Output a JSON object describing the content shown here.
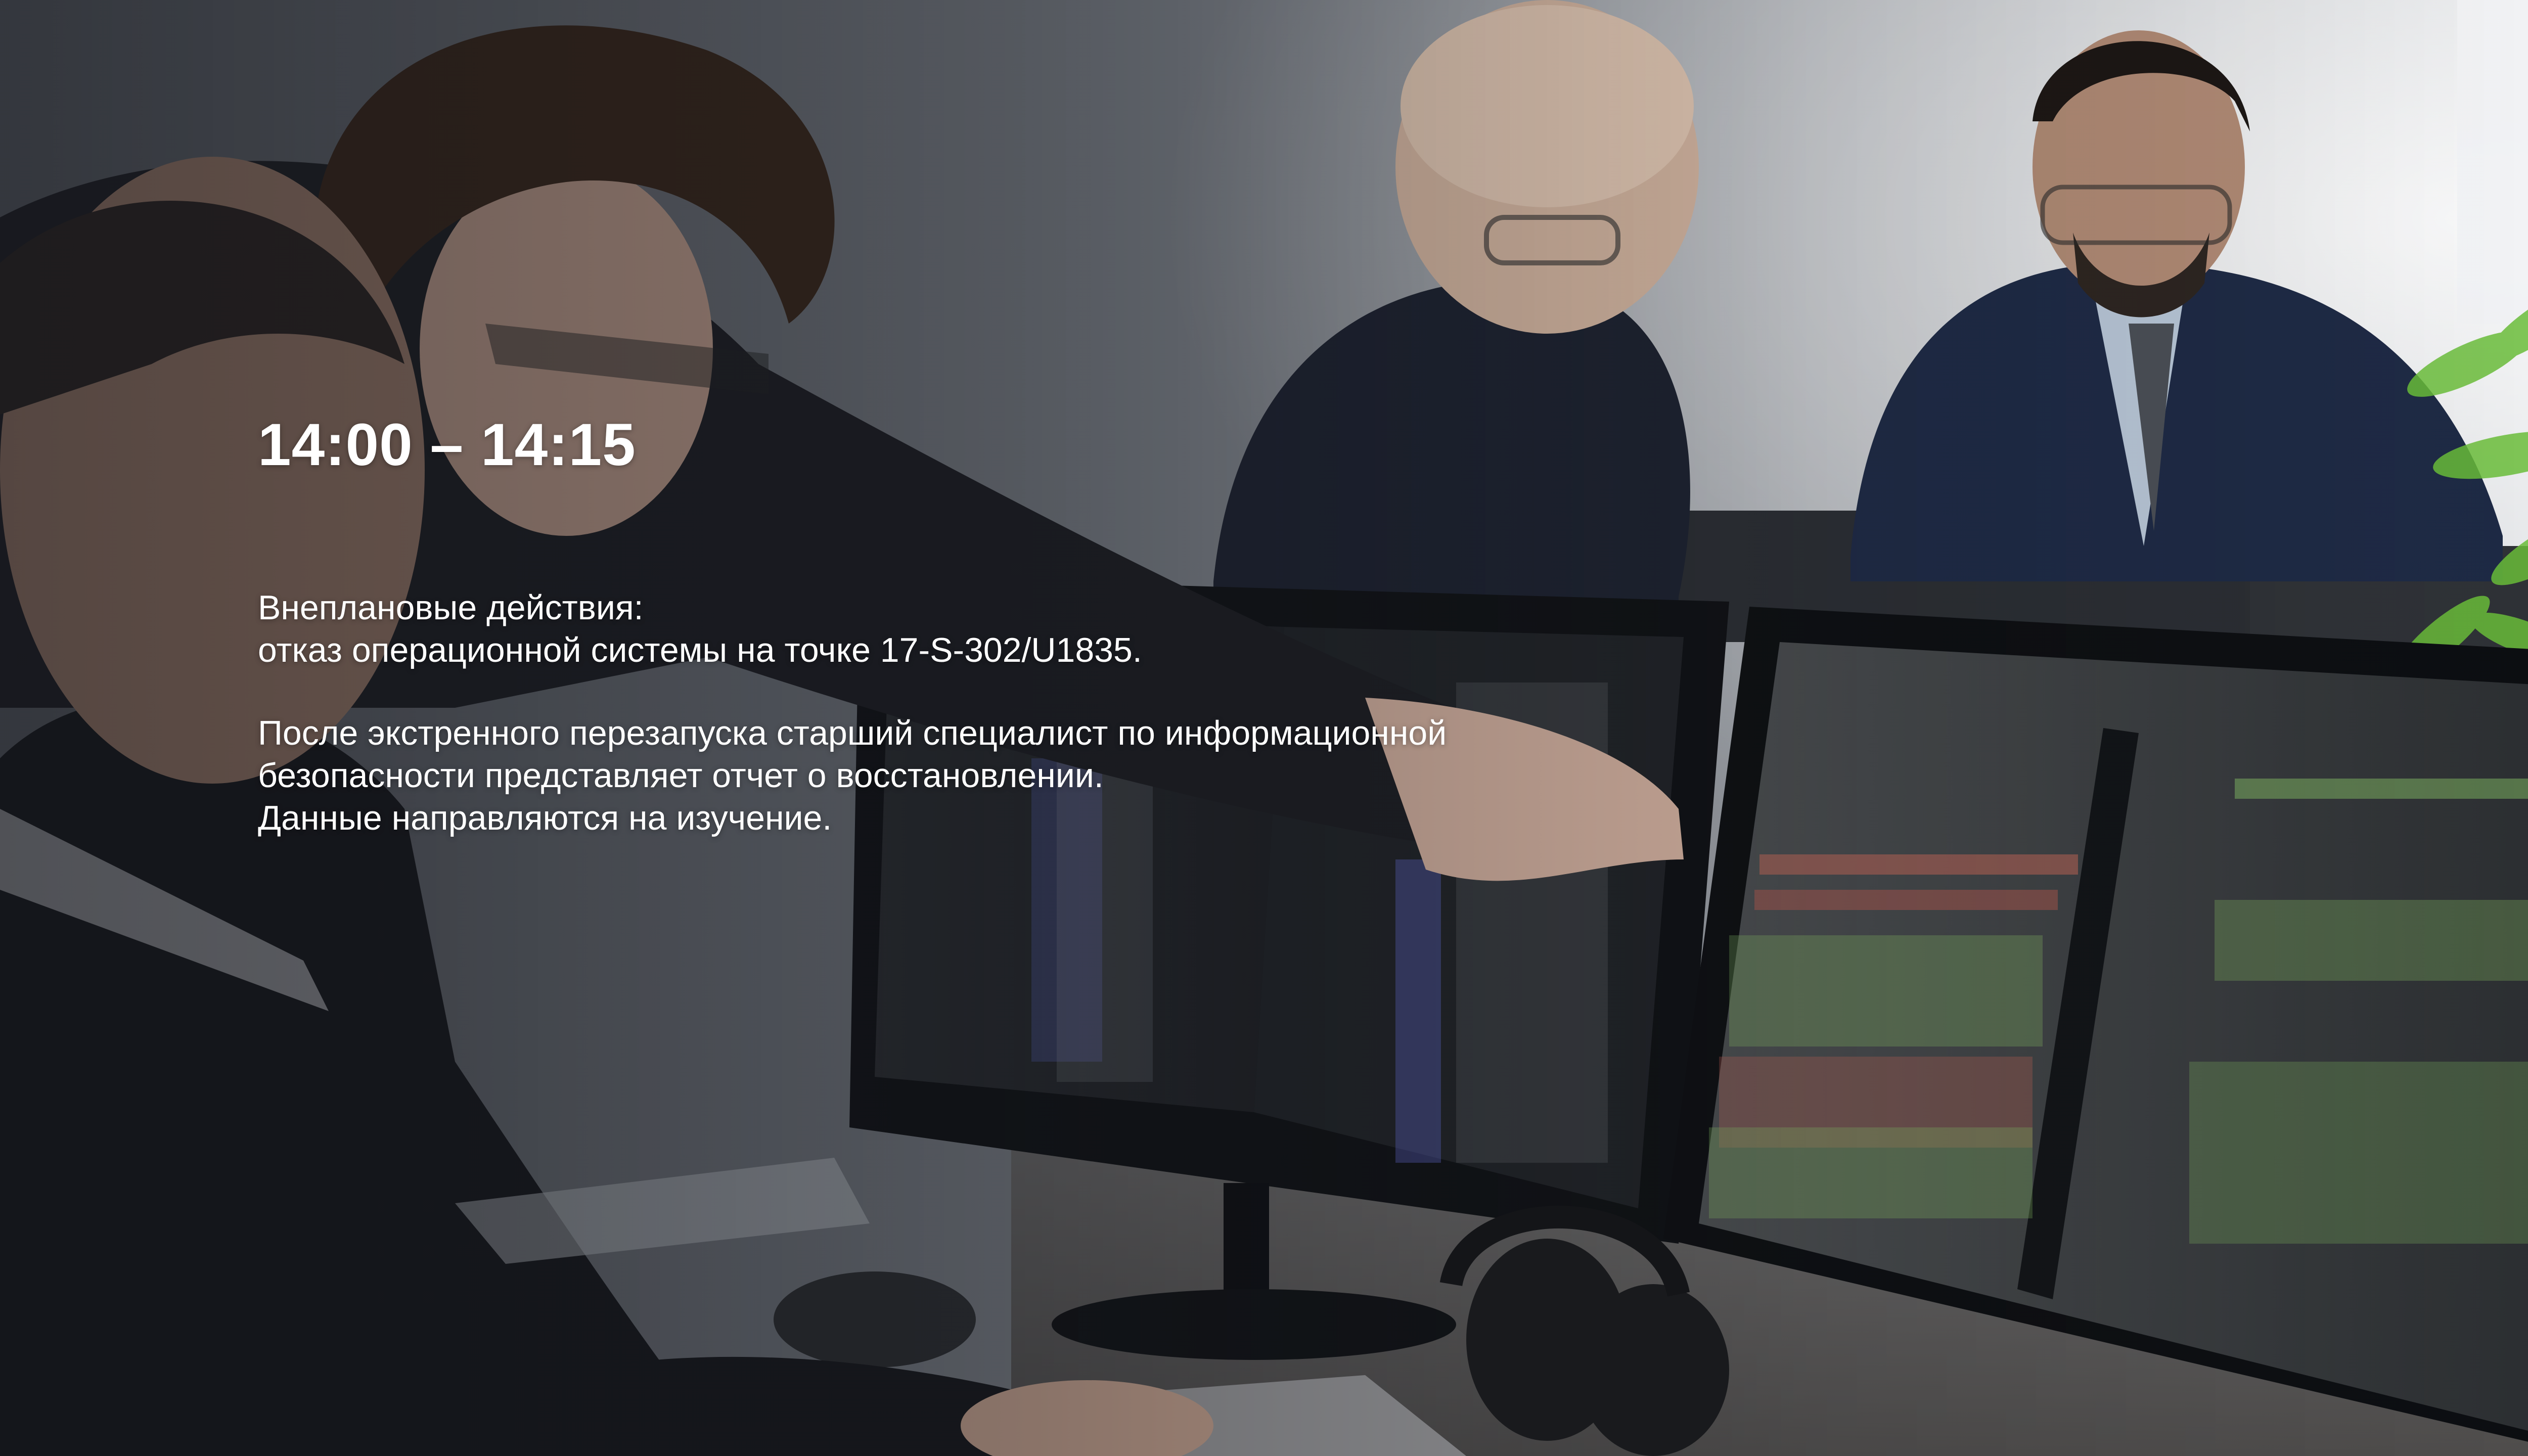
{
  "slide": {
    "time_range": "14:00 – 14:15",
    "paragraph_1": "Внеплановые действия:\nотказ операционной системы на точке 17-S-302/U1835.",
    "paragraph_2": "После экстренного перезапуска старший специалист по информационной\nбезопасности представляет отчет о восстановлении.\nДанные направляются на изучение."
  },
  "photo": {
    "subject": "four people in an office working at computer monitors showing code and terminal output",
    "colors": {
      "wall": "#8f949b",
      "monitor_frame": "#111317",
      "screen_dark": "#1f2226",
      "code_green": "#8fcf6b",
      "code_red": "#d46b5a",
      "plant": "#6bbf3a",
      "text": "#ffffff"
    }
  }
}
